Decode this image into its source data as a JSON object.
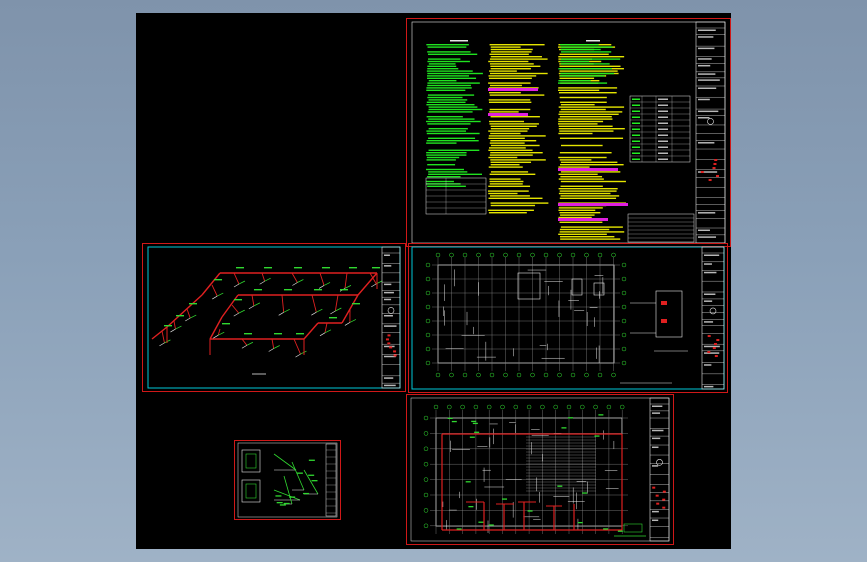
{
  "viewer": {
    "background_top": "#7f93ab",
    "background_bottom": "#9fb2c6",
    "canvas_color": "#000000"
  },
  "colors": {
    "frame_red": "#d01818",
    "frame_cyan": "#00c8d8",
    "line_white": "#e6e6e6",
    "pipe_red": "#e02020",
    "text_green": "#22ee22",
    "text_yellow": "#f0f000",
    "text_magenta": "#e020e0",
    "grid_gray": "#8a8a8a",
    "dim_green": "#30d830"
  },
  "sheets": [
    {
      "id": "sheet-notes",
      "kind": "design-notes"
    },
    {
      "id": "sheet-isometric",
      "kind": "isometric-pipe-system"
    },
    {
      "id": "sheet-floor-plan-upper",
      "kind": "floor-plan"
    },
    {
      "id": "sheet-detail",
      "kind": "detail-drawing"
    },
    {
      "id": "sheet-floor-plan-lower",
      "kind": "floor-plan-with-pipes"
    }
  ]
}
